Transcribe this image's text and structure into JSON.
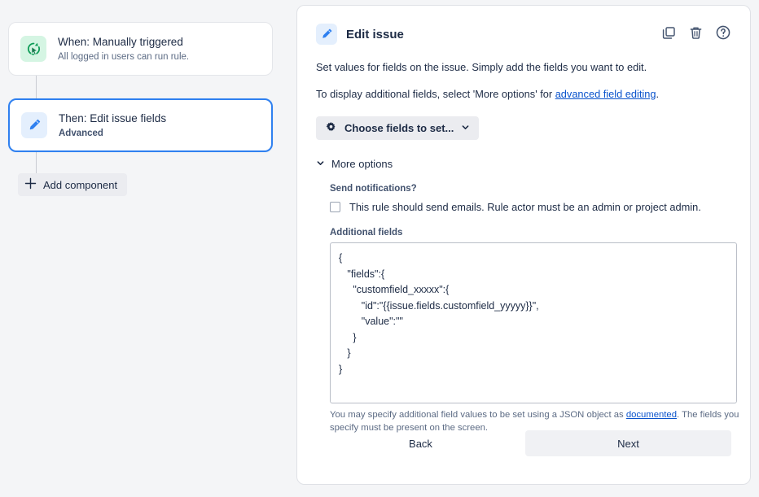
{
  "rule_chain": {
    "components": [
      {
        "icon": "manual-trigger-cursor-icon",
        "title": "When: Manually triggered",
        "subtitle": "All logged in users can run rule."
      },
      {
        "icon": "edit-pencil-icon",
        "title": "Then: Edit issue fields",
        "subtitle": "Advanced"
      }
    ],
    "add_component_label": "Add component",
    "add_component_icon": "plus-icon"
  },
  "panel": {
    "icon": "edit-pencil-icon",
    "title": "Edit issue",
    "actions": [
      {
        "icon": "duplicate-icon",
        "name": "duplicate-component-button"
      },
      {
        "icon": "trash-icon",
        "name": "delete-component-button"
      },
      {
        "icon": "help-icon",
        "name": "help-button"
      }
    ],
    "description_1": "Set values for fields on the issue. Simply add the fields you want to edit.",
    "description_2_before": "To display additional fields, select 'More options' for ",
    "description_2_link": "advanced field editing",
    "description_2_after": ".",
    "choose_fields": {
      "icon": "gear-icon",
      "label": "Choose fields to set...",
      "chevron": "chevron-down-icon"
    },
    "more_options": {
      "chevron": "chevron-down-icon",
      "label": "More options"
    },
    "send_notifications": {
      "label": "Send notifications?",
      "checkbox_checked": false,
      "checkbox_label": "This rule should send emails. Rule actor must be an admin or project admin."
    },
    "additional_fields": {
      "label": "Additional fields",
      "value": "{\n   \"fields\":{\n     \"customfield_xxxxx\":{\n        \"id\":\"{{issue.fields.customfield_yyyyy}}\",\n        \"value\":\"\"\n     }\n   }\n}",
      "placeholder": "",
      "helper_before": "You may specify additional field values to be set using a JSON object as ",
      "helper_link": "documented",
      "helper_after": ". The fields you specify must be present on the screen."
    },
    "footer": {
      "back_label": "Back",
      "next_label": "Next"
    }
  },
  "colors": {
    "page_background": "#f4f5f7",
    "panel_background": "#ffffff",
    "accent_blue": "#2f80f0",
    "link_blue": "#0a53cc",
    "trigger_icon_bg": "#d5f5e3",
    "action_icon_bg": "#e4effd",
    "button_grey": "#ebecf0",
    "text_primary": "#1d2b45",
    "text_muted": "#5c6b84"
  }
}
